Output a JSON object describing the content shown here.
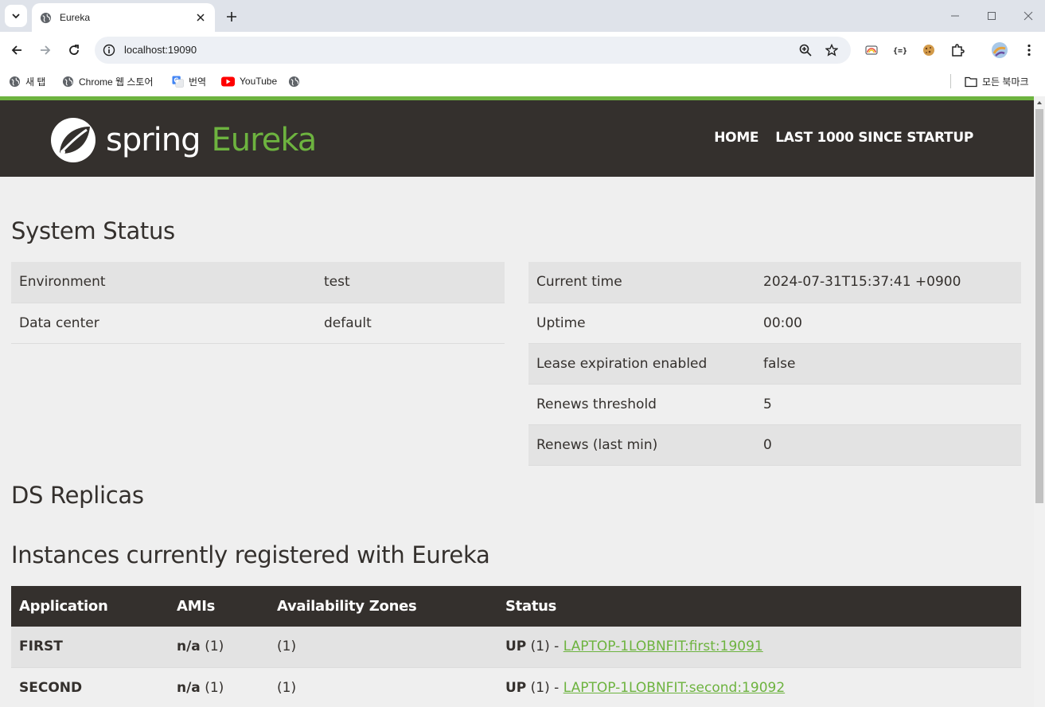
{
  "browser": {
    "tab_title": "Eureka",
    "url": "localhost:19090",
    "bookmarks": [
      "새 탭",
      "Chrome 웹 스토어",
      "번역",
      "YouTube"
    ],
    "all_bookmarks": "모든 북마크"
  },
  "header": {
    "logo_spring": "spring",
    "logo_eureka": "Eureka",
    "nav": [
      "HOME",
      "LAST 1000 SINCE STARTUP"
    ]
  },
  "system_status": {
    "title": "System Status",
    "left": [
      {
        "label": "Environment",
        "value": "test"
      },
      {
        "label": "Data center",
        "value": "default"
      }
    ],
    "right": [
      {
        "label": "Current time",
        "value": "2024-07-31T15:37:41 +0900"
      },
      {
        "label": "Uptime",
        "value": "00:00"
      },
      {
        "label": "Lease expiration enabled",
        "value": "false"
      },
      {
        "label": "Renews threshold",
        "value": "5"
      },
      {
        "label": "Renews (last min)",
        "value": "0"
      }
    ]
  },
  "ds_replicas": {
    "title": "DS Replicas"
  },
  "instances": {
    "title": "Instances currently registered with Eureka",
    "headers": [
      "Application",
      "AMIs",
      "Availability Zones",
      "Status"
    ],
    "rows": [
      {
        "application": "FIRST",
        "ami_bold": "n/a",
        "ami_count": " (1)",
        "zones": "(1)",
        "status_prefix": "UP",
        "status_count": " (1) - ",
        "instance_link": "LAPTOP-1LOBNFIT:first:19091"
      },
      {
        "application": "SECOND",
        "ami_bold": "n/a",
        "ami_count": " (1)",
        "zones": "(1)",
        "status_prefix": "UP",
        "status_count": " (1) - ",
        "instance_link": "LAPTOP-1LOBNFIT:second:19092"
      }
    ]
  },
  "colors": {
    "spring_green": "#6db33f",
    "header_dark": "#34302d",
    "page_bg": "#efefef",
    "row_stripe": "#e3e3e3"
  }
}
